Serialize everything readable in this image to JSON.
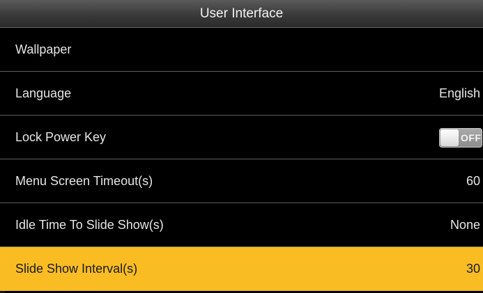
{
  "title": "User Interface",
  "items": [
    {
      "label": "Wallpaper",
      "value": ""
    },
    {
      "label": "Language",
      "value": "English"
    },
    {
      "label": "Lock Power Key",
      "toggle": "OFF",
      "toggle_state": "off"
    },
    {
      "label": "Menu Screen Timeout(s)",
      "value": "60"
    },
    {
      "label": "Idle Time To Slide Show(s)",
      "value": "None"
    },
    {
      "label": "Slide Show Interval(s)",
      "value": "30",
      "selected": true
    }
  ],
  "colors": {
    "selected_bg": "#f9bd23",
    "background": "#000000",
    "toggle_off": "#9a9a9a"
  }
}
